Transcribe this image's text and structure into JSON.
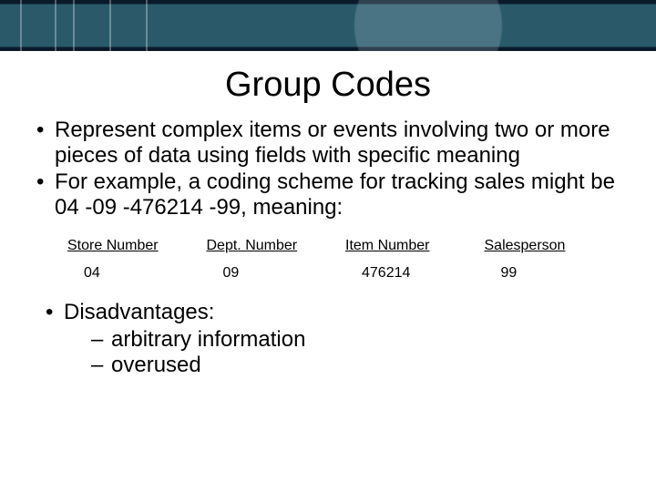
{
  "title": "Group Codes",
  "bullets": {
    "b1": "Represent complex items or events involving two or more pieces of data using fields with specific meaning",
    "b2": "For example, a coding scheme for tracking sales might be 04 -09 -476214 -99, meaning:"
  },
  "table": {
    "headers": [
      "Store Number",
      "Dept. Number",
      "Item Number",
      "Salesperson"
    ],
    "values": [
      "04",
      "09",
      "476214",
      "99"
    ]
  },
  "disadvantages": {
    "label": "Disadvantages:",
    "items": [
      "arbitrary information",
      "overused"
    ]
  }
}
